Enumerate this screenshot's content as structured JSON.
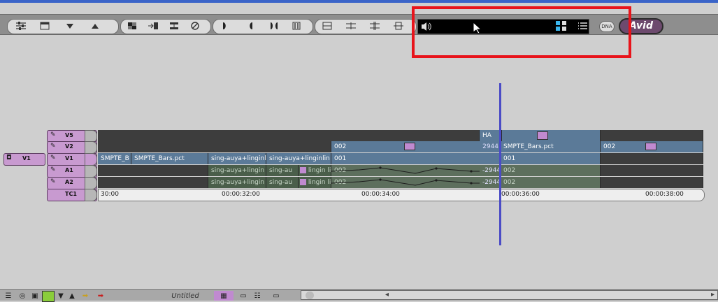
{
  "toolbar": {
    "icons": [
      "settings-sliders-icon",
      "window-icon",
      "down-arrow-icon",
      "up-arrow-icon",
      "checker-icon",
      "step-in-icon",
      "lift-icon",
      "null-icon",
      "mark-in-icon",
      "mark-out-icon",
      "mark-clip-icon",
      "pause-icon",
      "splice-icon",
      "overwrite-icon",
      "extract-icon",
      "lift-overwrite-icon"
    ],
    "monitor_icon": "speaker-icon",
    "dna_label": "DNA",
    "brand_label": "Avid"
  },
  "tracks": [
    {
      "label": "V5"
    },
    {
      "label": "V2"
    },
    {
      "label": "V1",
      "source": "V1"
    },
    {
      "label": "A1"
    },
    {
      "label": "A2"
    },
    {
      "label": "TC1"
    }
  ],
  "timeline": {
    "v5_clips": [
      {
        "text": "HA"
      }
    ],
    "v2_clips": [
      {
        "text": "002"
      },
      {
        "text": "2944"
      },
      {
        "text": "SMPTE_Bars.pct"
      },
      {
        "text": "002"
      }
    ],
    "v1_clips": [
      {
        "text": "SMPTE_B"
      },
      {
        "text": "SMPTE_Bars.pct"
      },
      {
        "text": "sing-auya+linginl"
      },
      {
        "text": "sing-auya+linginlin"
      },
      {
        "text": "001"
      },
      {
        "text": "001"
      }
    ],
    "a1_clips": [
      {
        "text": "sing-auya+lingin"
      },
      {
        "text": "sing-au"
      },
      {
        "text": "lingin lin"
      },
      {
        "text": "002"
      },
      {
        "text": "-2944"
      },
      {
        "text": "002"
      }
    ],
    "a2_clips": [
      {
        "text": "sing-auya+lingin"
      },
      {
        "text": "sing-au"
      },
      {
        "text": "lingin lin"
      },
      {
        "text": "002"
      },
      {
        "text": "-2944"
      },
      {
        "text": "002"
      }
    ],
    "timecodes": [
      "30:00",
      "00:00:32:00",
      "00:00:34:00",
      "00:00:36:00",
      "00:00:38:00"
    ]
  },
  "bottom": {
    "title": "Untitled"
  },
  "colors": {
    "accent": "#3a64c8",
    "highlight": "#e8141b",
    "track": "#c89ad0"
  }
}
